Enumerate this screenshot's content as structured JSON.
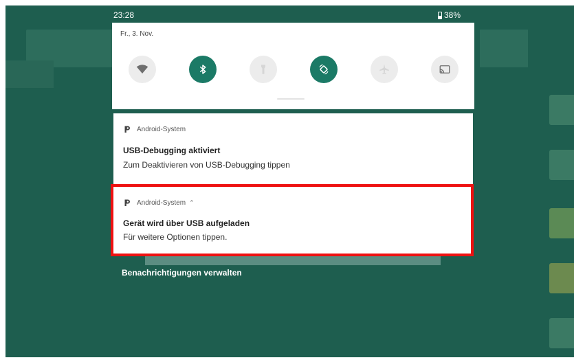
{
  "status_bar": {
    "time": "23:28",
    "battery": "38%"
  },
  "quick_settings": {
    "date": "Fr., 3. Nov.",
    "tiles": [
      {
        "icon": "wifi-icon",
        "active": false
      },
      {
        "icon": "bluetooth-icon",
        "active": true
      },
      {
        "icon": "flashlight-icon",
        "active": false
      },
      {
        "icon": "auto-rotate-icon",
        "active": true
      },
      {
        "icon": "airplane-mode-icon",
        "active": false
      },
      {
        "icon": "cast-icon",
        "active": false
      }
    ]
  },
  "notifications": [
    {
      "app": "Android-System",
      "title": "USB-Debugging aktiviert",
      "text": "Zum Deaktivieren von USB-Debugging tippen"
    },
    {
      "app": "Android-System",
      "title": "Gerät wird über USB aufgeladen",
      "text": "Für weitere Optionen tippen."
    }
  ],
  "manage_label": "Benachrichtigungen verwalten",
  "colors": {
    "accent": "#1b7a66",
    "background": "#1e5e4f",
    "highlight": "#ee1111"
  }
}
